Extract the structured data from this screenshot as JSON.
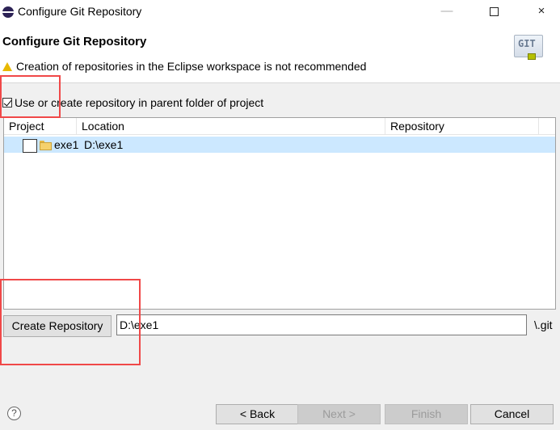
{
  "window": {
    "title": "Configure Git Repository",
    "minimize_icon": "minimize-icon",
    "maximize_icon": "maximize-icon",
    "close_glyph": "×"
  },
  "header": {
    "title": "Configure Git Repository",
    "message": "Creation of repositories in the Eclipse workspace is not recommended",
    "logo_text": "GIT"
  },
  "options": {
    "use_parent_label": "Use or create repository in parent folder of project",
    "use_parent_checked": true
  },
  "table": {
    "columns": [
      "Project",
      "Location",
      "Repository"
    ],
    "rows": [
      {
        "project": "exe1",
        "location": "D:\\exe1",
        "repository": "",
        "checked": false,
        "selected": true
      }
    ]
  },
  "repository": {
    "create_button_label": "Create Repository",
    "path_value": "D:\\exe1",
    "suffix": "\\.git"
  },
  "footer": {
    "help_glyph": "?",
    "back_label": "< Back",
    "next_label": "Next >",
    "finish_label": "Finish",
    "cancel_label": "Cancel"
  },
  "colors": {
    "selection": "#cce8ff",
    "annotation": "#f04848",
    "dialog_bg": "#f0f0f0"
  }
}
